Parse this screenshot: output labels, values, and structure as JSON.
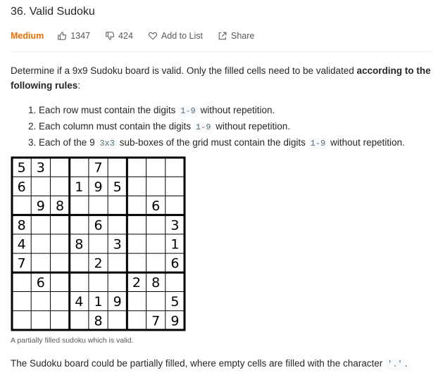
{
  "problem": {
    "title": "36. Valid Sudoku",
    "difficulty": "Medium",
    "likes": "1347",
    "dislikes": "424",
    "add_to_list": "Add to List",
    "share": "Share"
  },
  "description": {
    "intro_plain": "Determine if a 9x9 Sudoku board is valid. Only the filled cells need to be validated ",
    "intro_bold": "according to the following rules",
    "intro_end": ":",
    "rules": [
      {
        "num": "1. ",
        "before": "Each row must contain the digits ",
        "code": "1-9",
        "after": " without repetition."
      },
      {
        "num": "2. ",
        "before": "Each column must contain the digits ",
        "code": "1-9",
        "after": " without repetition."
      },
      {
        "num": "3. ",
        "before": "Each of the 9 ",
        "code": "3x3",
        "after": " sub-boxes of the grid must contain the digits ",
        "code2": "1-9",
        "after2": " without repetition."
      }
    ]
  },
  "board": {
    "rows": [
      [
        "5",
        "3",
        "",
        "",
        "7",
        "",
        "",
        "",
        ""
      ],
      [
        "6",
        "",
        "",
        "1",
        "9",
        "5",
        "",
        "",
        ""
      ],
      [
        "",
        "9",
        "8",
        "",
        "",
        "",
        "",
        "6",
        ""
      ],
      [
        "8",
        "",
        "",
        "",
        "6",
        "",
        "",
        "",
        "3"
      ],
      [
        "4",
        "",
        "",
        "8",
        "",
        "3",
        "",
        "",
        "1"
      ],
      [
        "7",
        "",
        "",
        "",
        "2",
        "",
        "",
        "",
        "6"
      ],
      [
        "",
        "6",
        "",
        "",
        "",
        "",
        "2",
        "8",
        ""
      ],
      [
        "",
        "",
        "",
        "4",
        "1",
        "9",
        "",
        "",
        "5"
      ],
      [
        "",
        "",
        "",
        "",
        "8",
        "",
        "",
        "7",
        "9"
      ]
    ],
    "caption": "A partially filled sudoku which is valid."
  },
  "footer": {
    "text": "The Sudoku board could be partially filled, where empty cells are filled with the character ",
    "code": "'.'",
    "end": "."
  }
}
